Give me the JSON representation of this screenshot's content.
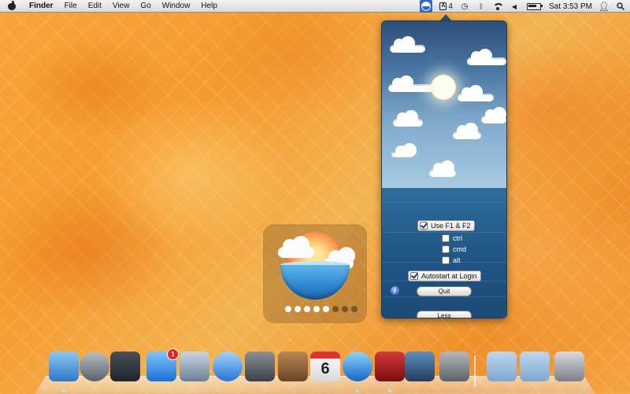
{
  "menubar": {
    "app_name": "Finder",
    "menus": [
      "File",
      "Edit",
      "View",
      "Go",
      "Window",
      "Help"
    ],
    "status": {
      "app_icon": "globe-icon",
      "adobe_count": "4",
      "clock": "Sat 3:53 PM",
      "battery_level": 0.75
    }
  },
  "popover": {
    "use_f1_f2": {
      "label": "Use F1 & F2",
      "checked": true
    },
    "modifiers": [
      {
        "label": "ctrl",
        "checked": false
      },
      {
        "label": "cmd",
        "checked": false
      },
      {
        "label": "alt",
        "checked": false
      }
    ],
    "autostart": {
      "label": "Autostart at Login",
      "checked": true
    },
    "quit_label": "Quit",
    "less_label": "Less"
  },
  "hud": {
    "level_total": 8,
    "level_on": 5
  },
  "dock": {
    "items": [
      {
        "name": "finder",
        "icon": "finder-icon",
        "colors": [
          "#8cc7f2",
          "#2f77c9"
        ]
      },
      {
        "name": "launchpad",
        "icon": "rocket-icon",
        "colors": [
          "#b9bdc4",
          "#5b616b"
        ]
      },
      {
        "name": "mission-control",
        "icon": "mission-control-icon",
        "colors": [
          "#4a4f59",
          "#1f232a"
        ]
      },
      {
        "name": "app-store",
        "icon": "app-store-icon",
        "colors": [
          "#7fc6ff",
          "#1a6fd6"
        ],
        "badge": "1"
      },
      {
        "name": "mail-stamp",
        "icon": "stamp-icon",
        "colors": [
          "#c9d6e4",
          "#6d7f95"
        ]
      },
      {
        "name": "safari",
        "icon": "compass-icon",
        "colors": [
          "#9fd4ff",
          "#2a74d0"
        ]
      },
      {
        "name": "facetime",
        "icon": "camera-icon",
        "colors": [
          "#8b9097",
          "#3b4047"
        ]
      },
      {
        "name": "address-book",
        "icon": "address-book-icon",
        "colors": [
          "#b88655",
          "#6c4422"
        ]
      },
      {
        "name": "ical",
        "icon": "calendar-icon",
        "colors": [
          "#ffffff",
          "#d8d8d8"
        ],
        "text": "6"
      },
      {
        "name": "itunes",
        "icon": "music-note-icon",
        "colors": [
          "#8fd3ff",
          "#1566c8"
        ]
      },
      {
        "name": "photo-booth",
        "icon": "curtain-icon",
        "colors": [
          "#d23a3a",
          "#7a0f10"
        ]
      },
      {
        "name": "iphoto",
        "icon": "photo-icon",
        "colors": [
          "#5a8fbf",
          "#263c5a"
        ]
      },
      {
        "name": "system-preferences",
        "icon": "gear-icon",
        "colors": [
          "#b4b8be",
          "#5c6168"
        ]
      },
      {
        "name": "applications-folder",
        "icon": "folder-icon",
        "colors": [
          "#bfd7ef",
          "#7fa6cf"
        ]
      },
      {
        "name": "downloads-folder",
        "icon": "downloads-folder-icon",
        "colors": [
          "#bfd7ef",
          "#7fa6cf"
        ]
      },
      {
        "name": "trash",
        "icon": "trash-icon",
        "colors": [
          "#d7dadf",
          "#7c8087"
        ]
      }
    ]
  }
}
